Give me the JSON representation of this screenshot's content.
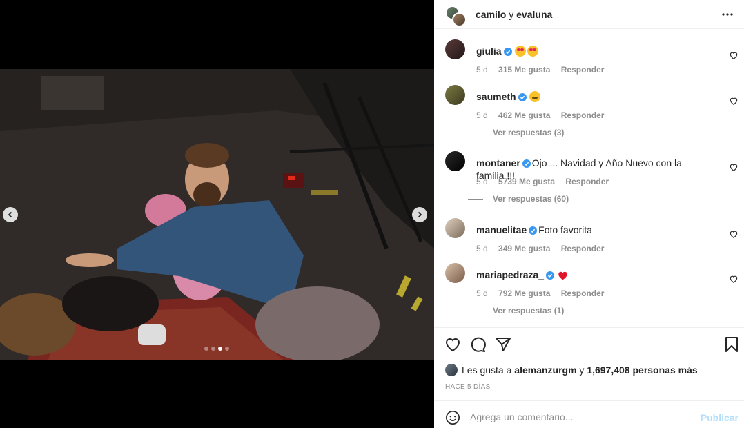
{
  "post": {
    "author_1": "camilo",
    "joiner": "y",
    "author_2": "evaluna"
  },
  "comments": [
    {
      "user": "giulia",
      "verified": true,
      "text": "",
      "emoji": [
        "heart-eyes",
        "heart-eyes"
      ],
      "age": "5 d",
      "likes": "315 Me gusta",
      "reply": "Responder",
      "avatar_color": "#3b2a2a"
    },
    {
      "user": "saumeth",
      "verified": true,
      "text": "",
      "emoji": [
        "grin"
      ],
      "age": "5 d",
      "likes": "462 Me gusta",
      "reply": "Responder",
      "view_replies": "Ver respuestas (3)",
      "avatar_color": "#6b6a3a"
    },
    {
      "user": "montaner",
      "verified": true,
      "text": "Ojo ... Navidad y Año Nuevo con la familia !!!",
      "age": "5 d",
      "likes": "5739 Me gusta",
      "reply": "Responder",
      "view_replies": "Ver respuestas (60)",
      "avatar_color": "#1a1a1a"
    },
    {
      "user": "manuelitae",
      "verified": true,
      "text": "Foto favorita",
      "age": "5 d",
      "likes": "349 Me gusta",
      "reply": "Responder",
      "avatar_color": "#c9b8a8"
    },
    {
      "user": "mariapedraza_",
      "verified": true,
      "text": "",
      "emoji": [
        "red-heart"
      ],
      "age": "5 d",
      "likes": "792 Me gusta",
      "reply": "Responder",
      "view_replies": "Ver respuestas (1)",
      "avatar_color": "#b8a290"
    }
  ],
  "likes": {
    "prefix": "Les gusta a",
    "user": "alemanzurgm",
    "joiner": "y",
    "count": "1,697,408 personas más"
  },
  "timestamp": "HACE 5 DÍAS",
  "comment_box": {
    "placeholder": "Agrega un comentario...",
    "publish": "Publicar"
  },
  "carousel": {
    "current_index": 2,
    "count": 4
  },
  "colors": {
    "verified": "#3897f0",
    "publish_disabled": "#b2dffc",
    "meta": "#8e8e8e"
  }
}
